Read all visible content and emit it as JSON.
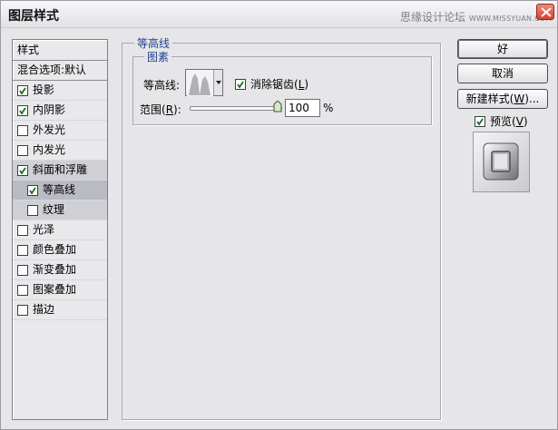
{
  "window": {
    "title": "图层样式",
    "watermark_main": "思缘设计论坛",
    "watermark_site": "WWW.MISSYUAN.COM",
    "close_icon": "close-icon"
  },
  "styles_panel": {
    "header": "样式",
    "blend_options": "混合选项:默认",
    "items": [
      {
        "label": "投影",
        "checked": true
      },
      {
        "label": "内阴影",
        "checked": true
      },
      {
        "label": "外发光",
        "checked": false
      },
      {
        "label": "内发光",
        "checked": false
      },
      {
        "label": "斜面和浮雕",
        "checked": true
      },
      {
        "label": "等高线",
        "checked": true,
        "sub": true,
        "selected": true
      },
      {
        "label": "纹理",
        "checked": false,
        "sub": true
      },
      {
        "label": "光泽",
        "checked": false
      },
      {
        "label": "颜色叠加",
        "checked": false
      },
      {
        "label": "渐变叠加",
        "checked": false
      },
      {
        "label": "图案叠加",
        "checked": false
      },
      {
        "label": "描边",
        "checked": false
      }
    ]
  },
  "contour_group": {
    "legend": "等高线",
    "inner_legend": "图素",
    "contour_label": "等高线:",
    "antialias_label": "消除锯齿(",
    "antialias_key": "L",
    "antialias_close": ")",
    "antialias_checked": true,
    "range_label_prefix": "范围(",
    "range_key": "R",
    "range_label_suffix": "):",
    "range_value": "100",
    "range_fraction": 1.0,
    "percent": "%"
  },
  "buttons": {
    "ok": "好",
    "cancel": "取消",
    "new_style_prefix": "新建样式(",
    "new_style_key": "W",
    "new_style_suffix": ")...",
    "preview_prefix": "预览(",
    "preview_key": "V",
    "preview_suffix": ")",
    "preview_checked": true
  }
}
